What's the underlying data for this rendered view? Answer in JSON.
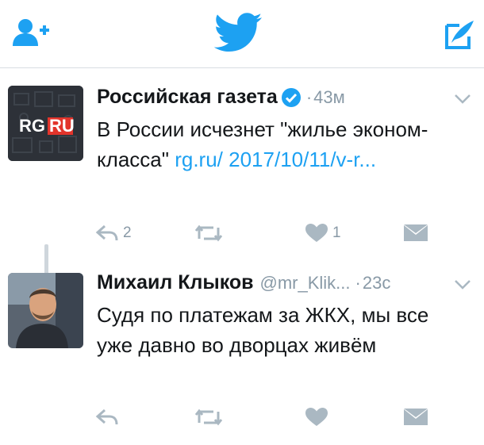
{
  "colors": {
    "accent": "#1da1f2",
    "action_gray": "#aab8c2",
    "secondary_text": "#8899a6",
    "rg_red": "#e2342b"
  },
  "topbar": {
    "left_icon": "add-user-icon",
    "center_icon": "twitter-bird-icon",
    "right_icon": "compose-tweet-icon"
  },
  "tweets": [
    {
      "name": "Российская газета",
      "verified": true,
      "time": "43м",
      "avatar": {
        "icon": "rg-logo",
        "text_rg": "RG",
        "text_ru": "RU"
      },
      "text": "В России исчезнет \"жилье эконом-класса\" ",
      "link": "rg.ru/ 2017/10/11/v-r...",
      "actions": {
        "reply_count": "2",
        "retweet_count": "",
        "like_count": "1"
      }
    },
    {
      "name": "Михаил Клыков",
      "handle": "@mr_Klik...",
      "time": "23с",
      "avatar": {
        "icon": "user-photo"
      },
      "text": "Судя по платежам за ЖКХ, мы все уже давно во дворцах живём",
      "actions": {
        "reply_count": "",
        "retweet_count": "",
        "like_count": ""
      }
    }
  ]
}
